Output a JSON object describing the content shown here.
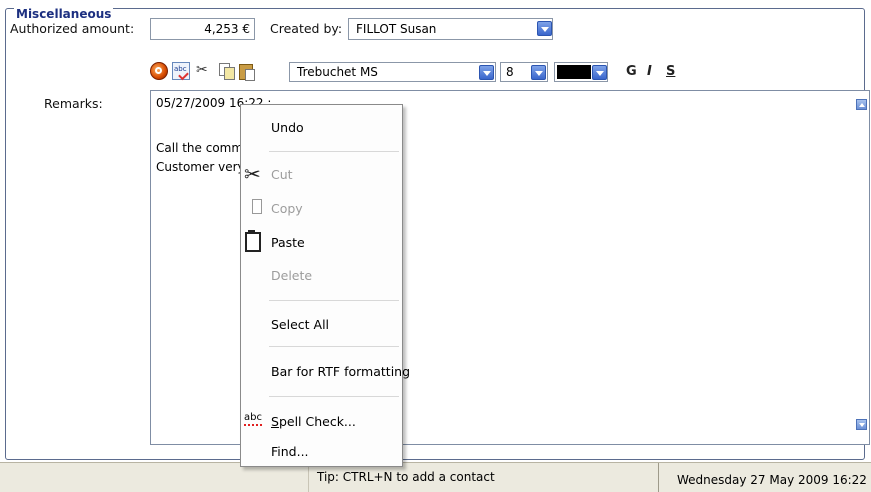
{
  "group": {
    "title": "Miscellaneous"
  },
  "amount": {
    "label": "Authorized amount:",
    "value": "4,253 €"
  },
  "created_by": {
    "label": "Created by:",
    "value": "FILLOT Susan"
  },
  "toolbar": {
    "font": "Trebuchet MS",
    "size": "8",
    "bold": "G",
    "italic": "I",
    "strike": "S",
    "color": "#000000"
  },
  "remarks": {
    "label": "Remarks:",
    "lines": [
      "05/27/2009 16:22 :",
      "Call the commer",
      "Customer very |"
    ]
  },
  "context_menu": {
    "undo": "Undo",
    "cut": "Cut",
    "copy": "Copy",
    "paste": "Paste",
    "delete": "Delete",
    "select_all": "Select All",
    "rtf_bar": "Bar for RTF formatting",
    "spell_check_first": "S",
    "spell_check_rest": "pell Check...",
    "find": "Find...",
    "spell_icon_text": "abc"
  },
  "statusbar": {
    "tip": "Tip:  CTRL+N to add a contact",
    "datetime": "Wednesday 27 May 2009 16:22"
  },
  "icons": {
    "undo": "undo-icon",
    "spell_check": "spell-check-icon",
    "cut": "scissors-icon",
    "copy": "copy-icon",
    "paste": "paste-icon"
  },
  "colors": {
    "group_title": "#1c2f80",
    "combo_button": "#3a66cc",
    "statusbar": "#eceadf",
    "disabled_text": "#9c9c9c"
  }
}
